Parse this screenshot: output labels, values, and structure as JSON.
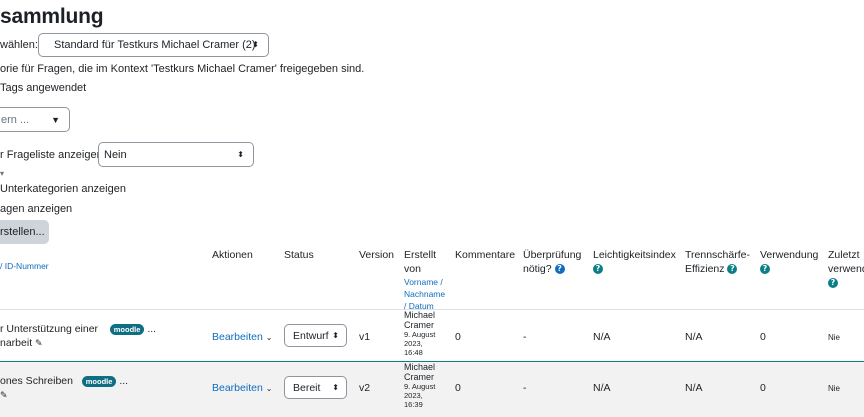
{
  "header": {
    "title": "sammlung"
  },
  "category_select": {
    "label": "wählen:",
    "value": "Standard für Testkurs Michael Cramer (2)"
  },
  "category_desc": "orie für Fragen, die im Kontext 'Testkurs Michael Cramer' freigegeben sind.",
  "tags_applied": "Tags angewendet",
  "filter_dropdown": {
    "label": "ern ..."
  },
  "show_text": {
    "label": "r Frageliste anzeigen?",
    "value": "Nein"
  },
  "subcategories": "Unterkategorien anzeigen",
  "old_questions": "agen anzeigen",
  "create_button": "rstellen...",
  "table": {
    "headers": {
      "question": "/ ID-Nummer",
      "actions": "Aktionen",
      "status": "Status",
      "version": "Version",
      "created_line1": "Erstellt",
      "created_line2": "von",
      "created_sub1": "Vorname /",
      "created_sub2": "Nachname",
      "created_sub3": "/ Datum",
      "comments": "Kommentare",
      "review_line1": "Überprüfung",
      "review_line2": "nötig?",
      "facility": "Leichtigkeitsindex",
      "disc_line1": "Trennschärfe-",
      "disc_line2": "Effizienz",
      "usage": "Verwendung",
      "lastused_line1": "Zuletzt",
      "lastused_line2": "verwendet"
    },
    "rows": [
      {
        "name_line1": "r Unterstützung einer",
        "name_line2": "narbeit",
        "badge": "moodle",
        "more": "...",
        "action": "Bearbeiten",
        "status": "Entwurf",
        "version": "v1",
        "author_first": "Michael",
        "author_last": "Cramer",
        "date1": "9. August",
        "date2": "2023,",
        "date3": "16:48",
        "comments": "0",
        "review": "-",
        "facility": "N/A",
        "discrimination": "N/A",
        "usage": "0",
        "last_used": "Nie"
      },
      {
        "name_line1": "ones Schreiben",
        "name_line2": "",
        "badge": "moodle",
        "more": "...",
        "action": "Bearbeiten",
        "status": "Bereit",
        "version": "v2",
        "author_first": "Michael",
        "author_last": "Cramer",
        "date1": "9. August",
        "date2": "2023,",
        "date3": "16:39",
        "comments": "0",
        "review": "-",
        "facility": "N/A",
        "discrimination": "N/A",
        "usage": "0",
        "last_used": "Nie"
      }
    ]
  },
  "colors": {
    "link": "#0f6cbf",
    "badge": "#0f6f82",
    "help": "#0f6cbf",
    "row_divider": "#0a7f8a"
  },
  "icons": {
    "help": "question-circle-icon",
    "edit": "pencil-icon",
    "caret": "chevron-down-icon"
  }
}
